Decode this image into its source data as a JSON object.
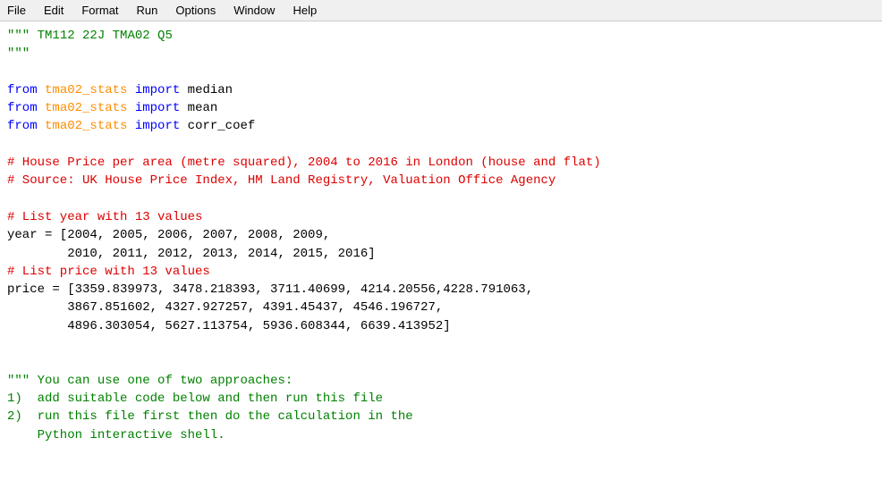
{
  "menubar": {
    "items": [
      "File",
      "Edit",
      "Format",
      "Run",
      "Options",
      "Window",
      "Help"
    ]
  },
  "editor": {
    "lines": [
      {
        "parts": [
          {
            "text": "\"\"\"",
            "cls": "c-string"
          },
          {
            "text": " ",
            "cls": "c-default"
          },
          {
            "text": "TM112 22J TMA02 Q5",
            "cls": "c-string"
          }
        ]
      },
      {
        "parts": [
          {
            "text": "\"\"\"",
            "cls": "c-string"
          }
        ]
      },
      {
        "parts": [
          {
            "text": "",
            "cls": "c-default"
          }
        ]
      },
      {
        "parts": [
          {
            "text": "from",
            "cls": "c-keyword"
          },
          {
            "text": " ",
            "cls": "c-default"
          },
          {
            "text": "tma02_stats",
            "cls": "c-module"
          },
          {
            "text": " ",
            "cls": "c-default"
          },
          {
            "text": "import",
            "cls": "c-keyword"
          },
          {
            "text": " median",
            "cls": "c-default"
          }
        ]
      },
      {
        "parts": [
          {
            "text": "from",
            "cls": "c-keyword"
          },
          {
            "text": " ",
            "cls": "c-default"
          },
          {
            "text": "tma02_stats",
            "cls": "c-module"
          },
          {
            "text": " ",
            "cls": "c-default"
          },
          {
            "text": "import",
            "cls": "c-keyword"
          },
          {
            "text": " mean",
            "cls": "c-default"
          }
        ]
      },
      {
        "parts": [
          {
            "text": "from",
            "cls": "c-keyword"
          },
          {
            "text": " ",
            "cls": "c-default"
          },
          {
            "text": "tma02_stats",
            "cls": "c-module"
          },
          {
            "text": " ",
            "cls": "c-default"
          },
          {
            "text": "import",
            "cls": "c-keyword"
          },
          {
            "text": " corr_coef",
            "cls": "c-default"
          }
        ]
      },
      {
        "parts": [
          {
            "text": "",
            "cls": "c-default"
          }
        ]
      },
      {
        "parts": [
          {
            "text": "# House Price per area (metre squared), 2004 to 2016 in London (house and flat)",
            "cls": "c-comment"
          }
        ]
      },
      {
        "parts": [
          {
            "text": "# Source: UK House Price Index, HM Land Registry, Valuation Office Agency",
            "cls": "c-comment"
          }
        ]
      },
      {
        "parts": [
          {
            "text": "",
            "cls": "c-default"
          }
        ]
      },
      {
        "parts": [
          {
            "text": "# List year with 13 values",
            "cls": "c-comment"
          }
        ]
      },
      {
        "parts": [
          {
            "text": "year = [2004, 2005, 2006, 2007, 2008, 2009,",
            "cls": "c-default"
          }
        ]
      },
      {
        "parts": [
          {
            "text": "        2010, 2011, 2012, 2013, 2014, 2015, 2016]",
            "cls": "c-default"
          }
        ]
      },
      {
        "parts": [
          {
            "text": "# List price with 13 values",
            "cls": "c-comment"
          }
        ]
      },
      {
        "parts": [
          {
            "text": "price = [3359.839973, 3478.218393, 3711.40699, 4214.20556,4228.791063,",
            "cls": "c-default"
          }
        ]
      },
      {
        "parts": [
          {
            "text": "        3867.851602, 4327.927257, 4391.45437, 4546.196727,",
            "cls": "c-default"
          }
        ]
      },
      {
        "parts": [
          {
            "text": "        4896.303054, 5627.113754, 5936.608344, 6639.413952]",
            "cls": "c-default"
          }
        ]
      },
      {
        "parts": [
          {
            "text": "",
            "cls": "c-default"
          }
        ]
      },
      {
        "parts": [
          {
            "text": "",
            "cls": "c-default"
          }
        ]
      },
      {
        "parts": [
          {
            "text": "\"\"\"",
            "cls": "c-string"
          },
          {
            "text": " You can use one of two approaches:",
            "cls": "c-string"
          }
        ]
      },
      {
        "parts": [
          {
            "text": "1)  add suitable code below and then run this file",
            "cls": "c-string"
          }
        ]
      },
      {
        "parts": [
          {
            "text": "2)  run this file first then do the calculation in the",
            "cls": "c-string"
          }
        ]
      },
      {
        "parts": [
          {
            "text": "    Python interactive shell.",
            "cls": "c-string"
          }
        ]
      }
    ]
  }
}
